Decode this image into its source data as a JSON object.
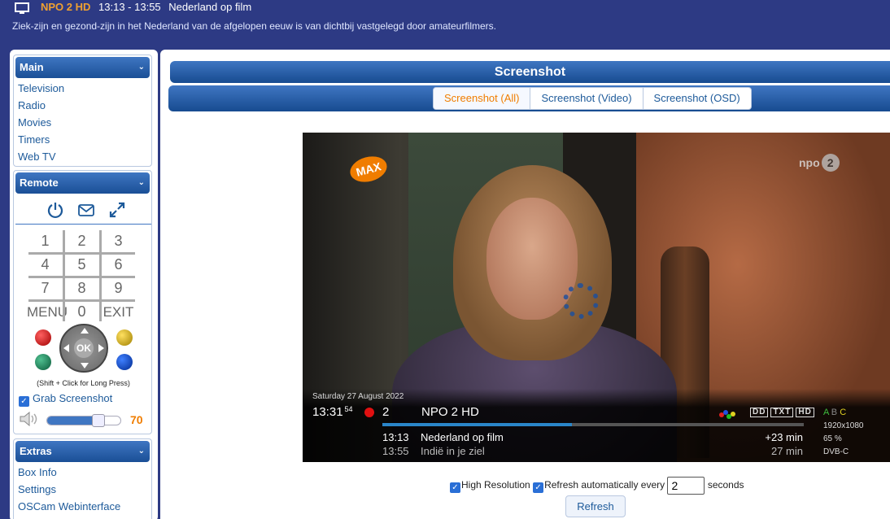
{
  "header": {
    "channel": "NPO 2 HD",
    "time": "13:13 - 13:55",
    "title": "Nederland op film",
    "description": "Ziek-zijn en gezond-zijn in het Nederland van de afgelopen eeuw is van dichtbij vastgelegd door amateurfilmers."
  },
  "sidebar": {
    "main": {
      "title": "Main",
      "items": [
        "Television",
        "Radio",
        "Movies",
        "Timers",
        "Web TV"
      ]
    },
    "remote": {
      "title": "Remote",
      "keys": [
        "1",
        "2",
        "3",
        "4",
        "5",
        "6",
        "7",
        "8",
        "9",
        "MENU",
        "0",
        "EXIT"
      ],
      "ok_label": "OK",
      "hint": "(Shift + Click for Long Press)",
      "grab_label": "Grab Screenshot",
      "volume": 70
    },
    "extras": {
      "title": "Extras",
      "items": [
        "Box Info",
        "Settings",
        "OSCam Webinterface"
      ]
    }
  },
  "main": {
    "title": "Screenshot",
    "tabs": [
      "Screenshot (All)",
      "Screenshot (Video)",
      "Screenshot (OSD)"
    ],
    "active_tab": 0
  },
  "osd": {
    "date": "Saturday 27 August 2022",
    "clock": "13:31",
    "seconds": "54",
    "channel_number": "2",
    "channel_name": "NPO 2 HD",
    "progress": 0.45,
    "now_time": "13:13",
    "now_title": "Nederland op film",
    "now_remaining": "+23 min",
    "next_time": "13:55",
    "next_title": "Indië in je ziel",
    "next_duration": "27 min",
    "badges": [
      "DD",
      "TXT",
      "HD"
    ],
    "abc": [
      "A",
      "B",
      "C"
    ],
    "resolution": "1920x1080",
    "signal": "65 %",
    "tuner": "DVB-C",
    "logo_left": "MAX",
    "logo_right_text": "npo",
    "logo_right_num": "2"
  },
  "controls": {
    "high_res_label": "High Resolution",
    "refresh_label": "Refresh automatically every",
    "refresh_value": "2",
    "seconds_label": "seconds",
    "refresh_button": "Refresh"
  },
  "colors": {
    "accent": "#f07d00",
    "header_bg": "#2d3a84",
    "link": "#1d5a9a"
  }
}
